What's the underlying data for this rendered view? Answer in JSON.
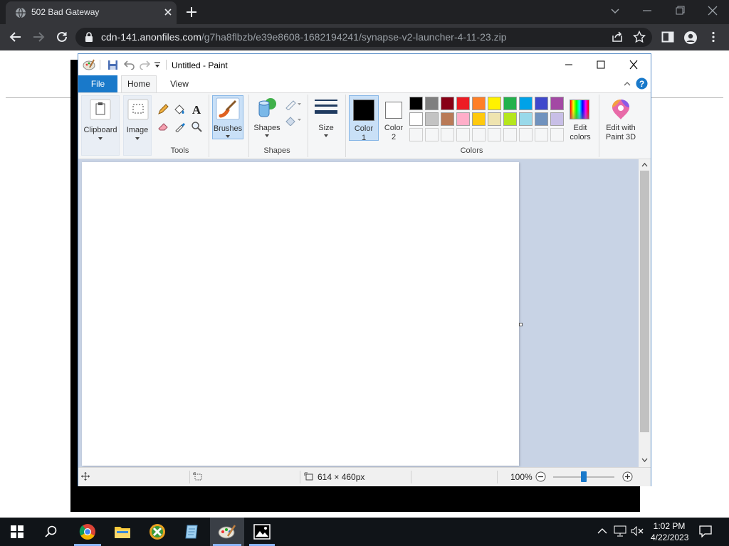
{
  "browser": {
    "tab_title": "502 Bad Gateway",
    "url_host": "cdn-141.anonfiles.com",
    "url_path": "/g7ha8flbzb/e39e8608-1682194241/synapse-v2-launcher-4-11-23.zip"
  },
  "paint": {
    "title": "Untitled - Paint",
    "tabs": {
      "file": "File",
      "home": "Home",
      "view": "View"
    },
    "ribbon": {
      "clipboard": "Clipboard",
      "image": "Image",
      "tools": "Tools",
      "brushes": "Brushes",
      "shapes_btn": "Shapes",
      "shapes_group": "Shapes",
      "size": "Size",
      "color1_line1": "Color",
      "color1_line2": "1",
      "color2_line1": "Color",
      "color2_line2": "2",
      "colors_group": "Colors",
      "edit_colors_line1": "Edit",
      "edit_colors_line2": "colors",
      "paint3d_line1": "Edit with",
      "paint3d_line2": "Paint 3D"
    },
    "palette_row1": [
      "#000000",
      "#7f7f7f",
      "#880015",
      "#ed1c24",
      "#ff7f27",
      "#fff200",
      "#22b14c",
      "#00a2e8",
      "#3f48cc",
      "#a349a4"
    ],
    "palette_row2": [
      "#ffffff",
      "#c3c3c3",
      "#b97a57",
      "#ffaec9",
      "#ffc90e",
      "#efe4b0",
      "#b5e61d",
      "#99d9ea",
      "#7092be",
      "#c8bfe7"
    ],
    "status": {
      "canvas_size": "614 × 460px",
      "zoom": "100%"
    }
  },
  "taskbar": {
    "time": "1:02 PM",
    "date": "4/22/2023"
  }
}
